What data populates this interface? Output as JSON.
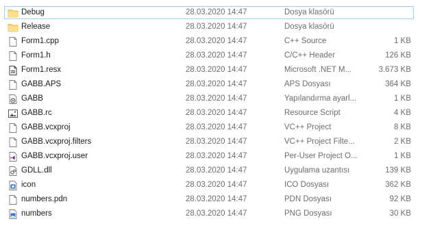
{
  "files": [
    {
      "name": "Debug",
      "date": "28.03.2020 14:47",
      "type": "Dosya klasörü",
      "size": "",
      "icon": "folder-icon",
      "selected": true
    },
    {
      "name": "Release",
      "date": "28.03.2020 14:47",
      "type": "Dosya klasörü",
      "size": "",
      "icon": "folder-icon"
    },
    {
      "name": "Form1.cpp",
      "date": "28.03.2020 14:47",
      "type": "C++ Source",
      "size": "1 KB",
      "icon": "file-icon"
    },
    {
      "name": "Form1.h",
      "date": "28.03.2020 14:47",
      "type": "C/C++ Header",
      "size": "126 KB",
      "icon": "file-icon"
    },
    {
      "name": "Form1.resx",
      "date": "28.03.2020 14:47",
      "type": "Microsoft .NET M...",
      "size": "3.673 KB",
      "icon": "resx-file-icon"
    },
    {
      "name": "GABB.APS",
      "date": "28.03.2020 14:47",
      "type": "APS Dosyası",
      "size": "364 KB",
      "icon": "file-icon"
    },
    {
      "name": "GABB",
      "date": "28.03.2020 14:47",
      "type": "Yapılandırma ayarl...",
      "size": "1 KB",
      "icon": "config-file-icon"
    },
    {
      "name": "GABB.rc",
      "date": "28.03.2020 14:47",
      "type": "Resource Script",
      "size": "4 KB",
      "icon": "resource-script-icon"
    },
    {
      "name": "GABB.vcxproj",
      "date": "28.03.2020 14:47",
      "type": "VC++ Project",
      "size": "8 KB",
      "icon": "file-icon"
    },
    {
      "name": "GABB.vcxproj.filters",
      "date": "28.03.2020 14:47",
      "type": "VC++ Project Filte...",
      "size": "2 KB",
      "icon": "file-icon"
    },
    {
      "name": "GABB.vcxproj.user",
      "date": "28.03.2020 14:47",
      "type": "Per-User Project O...",
      "size": "1 KB",
      "icon": "visual-studio-file-icon"
    },
    {
      "name": "GDLL.dll",
      "date": "28.03.2020 14:47",
      "type": "Uygulama uzantısı",
      "size": "139 KB",
      "icon": "dll-file-icon"
    },
    {
      "name": "icon",
      "date": "28.03.2020 14:47",
      "type": "ICO Dosyası",
      "size": "362 KB",
      "icon": "ico-file-icon"
    },
    {
      "name": "numbers.pdn",
      "date": "28.03.2020 14:47",
      "type": "PDN Dosyası",
      "size": "92 KB",
      "icon": "file-icon"
    },
    {
      "name": "numbers",
      "date": "28.03.2020 14:47",
      "type": "PNG Dosyası",
      "size": "30 KB",
      "icon": "png-file-icon"
    }
  ],
  "colors": {
    "selection_border": "#99d1ff",
    "folder_yellow": "#f8d775",
    "secondary_text": "#6d6d6d"
  }
}
